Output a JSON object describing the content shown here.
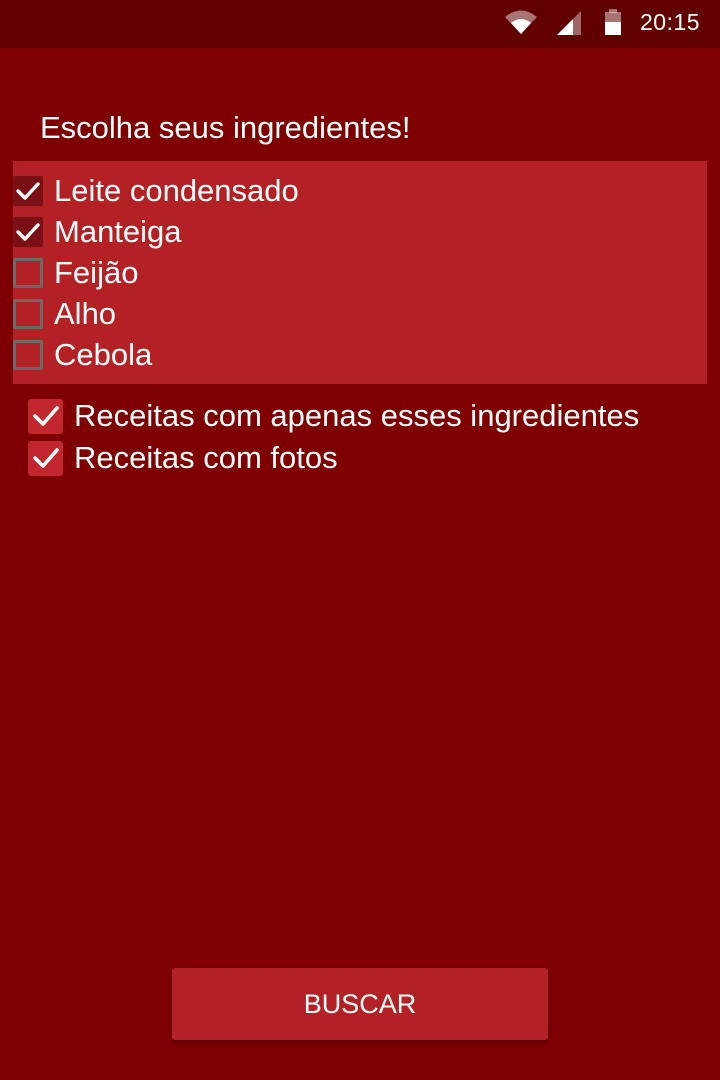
{
  "status_bar": {
    "time": "20:15",
    "icons": [
      "wifi-icon",
      "cell-signal-icon",
      "battery-icon"
    ]
  },
  "title": "Escolha seus ingredientes!",
  "ingredients": [
    {
      "label": "Leite condensado",
      "checked": true
    },
    {
      "label": "Manteiga",
      "checked": true
    },
    {
      "label": "Feijão",
      "checked": false
    },
    {
      "label": "Alho",
      "checked": false
    },
    {
      "label": "Cebola",
      "checked": false
    }
  ],
  "options": [
    {
      "label": "Receitas com apenas esses ingredientes",
      "checked": true
    },
    {
      "label": "Receitas com fotos",
      "checked": true
    }
  ],
  "search_button": "BUSCAR",
  "colors": {
    "background": "#7f0000",
    "status_bar": "#620000",
    "panel": "#b42125",
    "button": "#b42125",
    "checkbox_checked": "#7a1015",
    "checkbox_unchecked_border": "#6a6a6a"
  }
}
